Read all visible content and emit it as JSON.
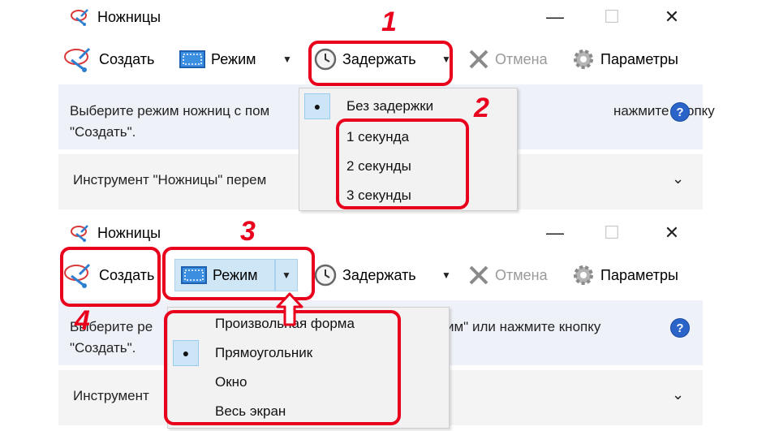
{
  "window1": {
    "title": "Ножницы",
    "toolbar": {
      "new_label": "Создать",
      "mode_label": "Режим",
      "delay_label": "Задержать",
      "cancel_label": "Отмена",
      "params_label": "Параметры"
    },
    "info_text": "Выберите режим ножниц с пом\n\"Создать\".",
    "info_text_right": "нажмите кнопку",
    "tool_row_text": "Инструмент \"Ножницы\" перем",
    "delay_menu": [
      {
        "label": "Без задержки",
        "selected": true
      },
      {
        "label": "1 секунда",
        "selected": false
      },
      {
        "label": "2 секунды",
        "selected": false
      },
      {
        "label": "3 секунды",
        "selected": false
      }
    ]
  },
  "window2": {
    "title": "Ножницы",
    "toolbar": {
      "new_label": "Создать",
      "mode_label": "Режим",
      "delay_label": "Задержать",
      "cancel_label": "Отмена",
      "params_label": "Параметры"
    },
    "info_text": "Выберите ре\n\"Создать\".",
    "info_text_right": "им\" или нажмите кнопку",
    "tool_row_text": "Инструмент",
    "mode_menu": [
      {
        "label": "Произвольная форма",
        "selected": false
      },
      {
        "label": "Прямоугольник",
        "selected": true
      },
      {
        "label": "Окно",
        "selected": false
      },
      {
        "label": "Весь экран",
        "selected": false
      }
    ]
  },
  "annotations": {
    "step1": "1",
    "step2": "2",
    "step3": "3",
    "step4": "4"
  },
  "colors": {
    "annotation_red": "#e8001c",
    "highlight_blue": "#cfe6f7",
    "info_bg": "#eef2f8"
  }
}
